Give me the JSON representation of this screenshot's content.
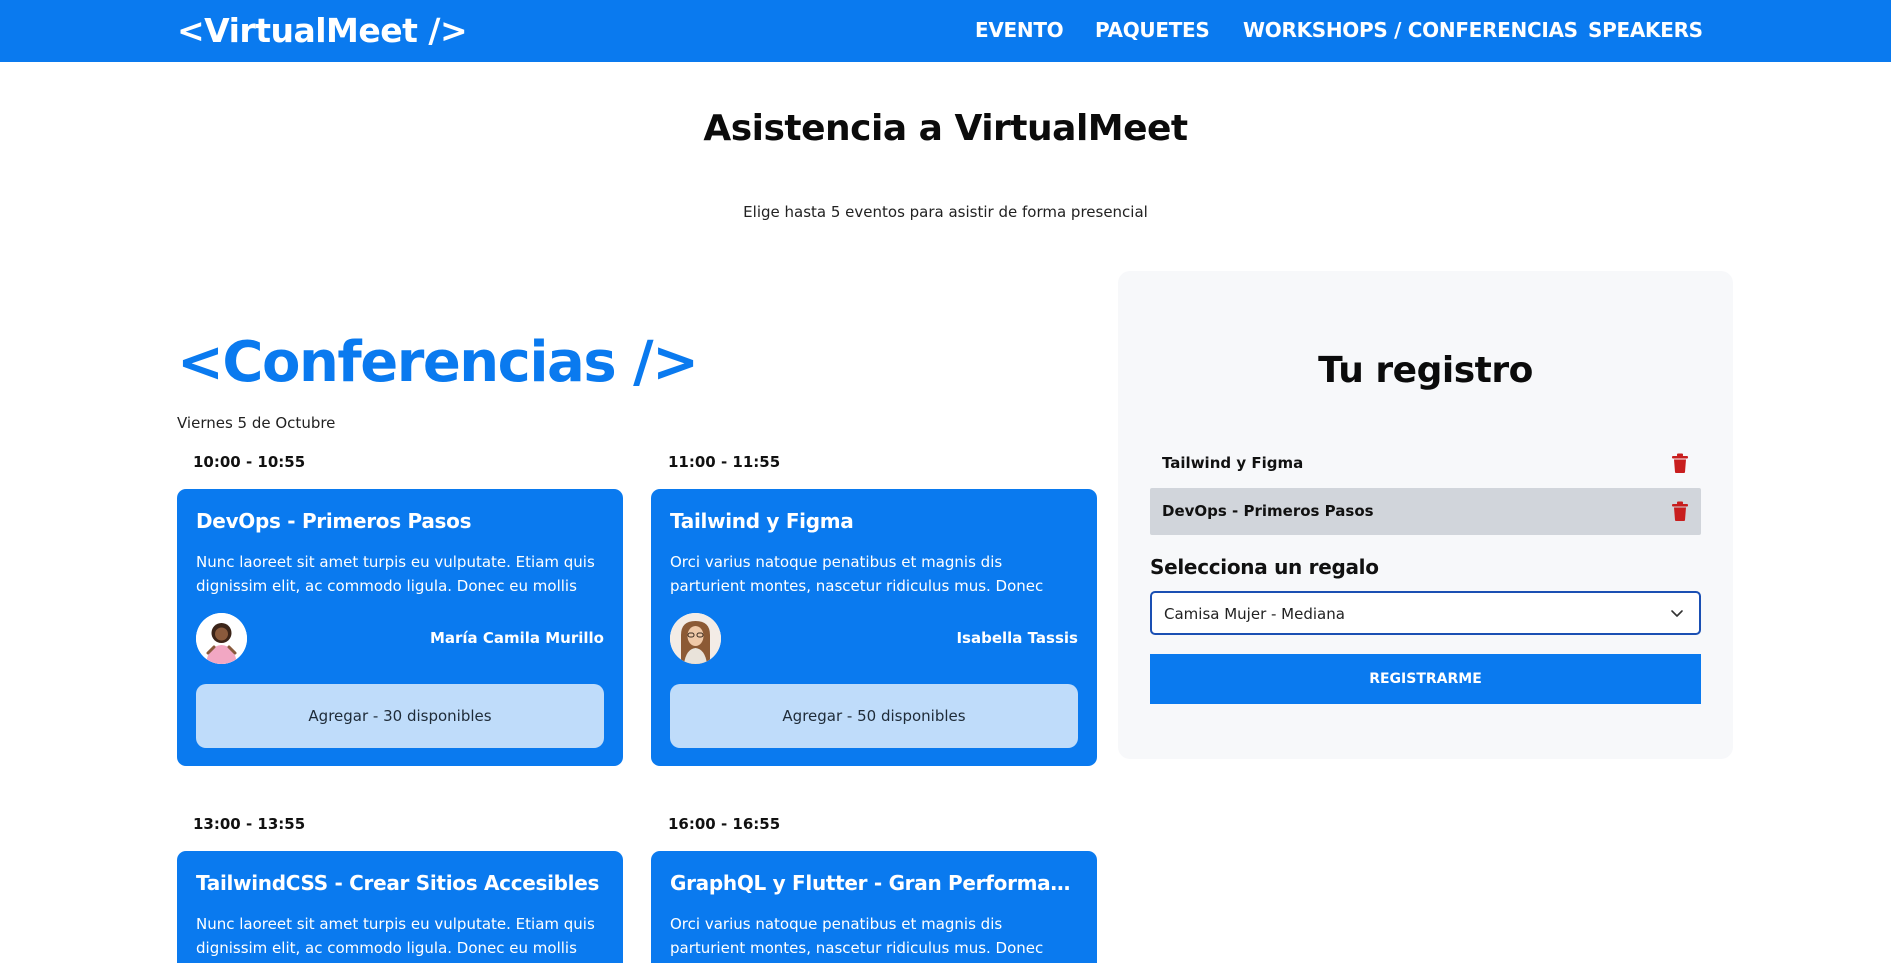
{
  "header": {
    "logo": "<VirtualMeet />",
    "nav": [
      "EVENTO",
      "PAQUETES",
      "WORKSHOPS / CONFERENCIAS",
      "SPEAKERS"
    ]
  },
  "page": {
    "title": "Asistencia a VirtualMeet",
    "subtitle": "Elige hasta 5 eventos para asistir de forma presencial"
  },
  "section": {
    "title": "<Conferencias />",
    "day": "Viernes 5 de Octubre"
  },
  "events": [
    {
      "time": "10:00 - 10:55",
      "title": "DevOps - Primeros Pasos",
      "description": "Nunc laoreet sit amet turpis eu vulputate. Etiam quis dignissim elit, ac commodo ligula. Donec eu mollis odio,...",
      "speaker": "María Camila Murillo",
      "button": "Agregar - 30 disponibles"
    },
    {
      "time": "11:00 - 11:55",
      "title": "Tailwind y Figma",
      "description": "Orci varius natoque penatibus et magnis dis parturient montes, nascetur ridiculus mus. Donec sodales...",
      "speaker": "Isabella Tassis",
      "button": "Agregar - 50 disponibles"
    },
    {
      "time": "13:00 - 13:55",
      "title": "TailwindCSS - Crear Sitios Accesibles",
      "description": "Nunc laoreet sit amet turpis eu vulputate. Etiam quis dignissim elit, ac commodo ligula. Donec eu mollis odio,..."
    },
    {
      "time": "16:00 - 16:55",
      "title": "GraphQL y Flutter - Gran Performance pa...",
      "description": "Orci varius natoque penatibus et magnis dis parturient montes, nascetur ridiculus mus. Donec sodales..."
    }
  ],
  "registration": {
    "title": "Tu registro",
    "items": [
      "Tailwind y Figma",
      "DevOps - Primeros Pasos"
    ],
    "gift_label": "Selecciona un regalo",
    "gift_selected": "Camisa Mujer - Mediana",
    "submit": "REGISTRARME"
  },
  "colors": {
    "primary": "#0a7aef",
    "add_button": "#bfdcfa",
    "trash": "#c81e1e",
    "panel": "#f7f8fa"
  }
}
